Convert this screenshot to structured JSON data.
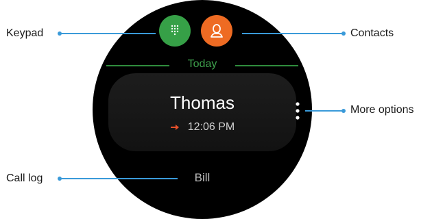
{
  "watch": {
    "section_label": "Today",
    "entry": {
      "name": "Thomas",
      "time": "12:06 PM",
      "call_type_icon": "outgoing-call-arrow"
    },
    "next_entry": {
      "name": "Bill"
    },
    "keypad_icon": "dialpad-icon",
    "contacts_icon": "person-icon",
    "more_icon": "vertical-dots-icon"
  },
  "callouts": {
    "keypad": "Keypad",
    "contacts": "Contacts",
    "more_options": "More options",
    "call_log": "Call log"
  },
  "colors": {
    "keypad_button": "#36a047",
    "contacts_button": "#ee6b23",
    "section_label": "#3fa34d",
    "outgoing_arrow": "#e8502a",
    "leader_line": "#3a9ad9"
  }
}
